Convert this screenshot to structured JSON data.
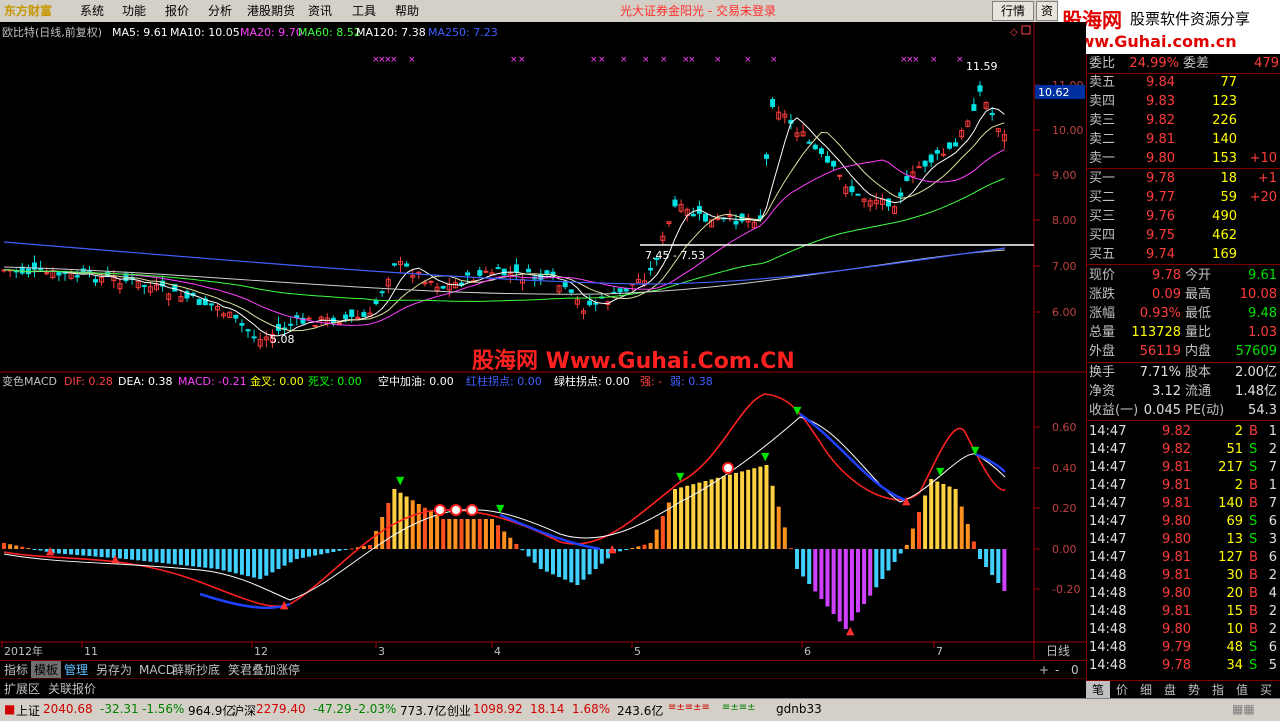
{
  "menubar": {
    "logo": "东方财富",
    "items": [
      "系统",
      "功能",
      "报价",
      "分析",
      "港股期货",
      "资讯",
      "工具",
      "帮助"
    ],
    "broker_text": "光大证券金阳光 - 交易未登录",
    "quote_button": "行情",
    "info_button": "资"
  },
  "banner": {
    "title": "股海网",
    "subtitle": "股票软件资源分享",
    "url": "Www.Guhai.com.cn"
  },
  "main_chart": {
    "title": "欧比特(日线,前复权)",
    "ma": [
      {
        "label": "MA5: 9.61",
        "color": "#ffffff"
      },
      {
        "label": "MA10: 10.05",
        "color": "#ffffff"
      },
      {
        "label": "MA20: 9.70",
        "color": "#ff40ff"
      },
      {
        "label": "MA60: 8.52",
        "color": "#40ff40"
      },
      {
        "label": "MA120: 7.38",
        "color": "#ffffff"
      },
      {
        "label": "MA250: 7.23",
        "color": "#4060ff"
      }
    ],
    "y_ticks": [
      "11.00",
      "10.00",
      "9.00",
      "8.00",
      "7.00",
      "6.00"
    ],
    "current_price_tag": "10.62",
    "annotation_high": "11.59",
    "annotation_low": "5.08",
    "annotation_range": "7.45 - 7.53",
    "watermark": "股海网 Www.Guhai.Com.CN"
  },
  "indicator": {
    "name": "变色MACD",
    "items": [
      {
        "label": "DIF: 0.28",
        "color": "#ff4040"
      },
      {
        "label": "DEA: 0.38",
        "color": "#ffffff"
      },
      {
        "label": "MACD: -0.21",
        "color": "#ff40ff"
      },
      {
        "label": "金叉: 0.00",
        "color": "#ffff00"
      },
      {
        "label": "死叉: 0.00",
        "color": "#00ff00"
      },
      {
        "label": "空中加油: 0.00",
        "color": "#ffffff"
      },
      {
        "label": "红柱拐点: 0.00",
        "color": "#4060ff"
      },
      {
        "label": "绿柱拐点: 0.00",
        "color": "#ffffff"
      },
      {
        "label": "强: -",
        "color": "#ff4040"
      },
      {
        "label": "弱: 0.38",
        "color": "#4060ff"
      }
    ],
    "y_ticks": [
      "0.60",
      "0.40",
      "0.20",
      "0.00",
      "-0.20"
    ]
  },
  "x_axis": {
    "labels": [
      "2012年",
      "11",
      "12",
      "3",
      "4",
      "5",
      "6",
      "7"
    ],
    "period": "日线"
  },
  "tabs": {
    "items": [
      "指标",
      "模板",
      "管理",
      "另存为",
      "MACD",
      "薛斯抄底",
      "笑君叠加涨停"
    ],
    "ext": [
      "扩展区",
      "关联报价"
    ],
    "controls": [
      "+",
      "-",
      "0"
    ]
  },
  "quote_panel": {
    "weibi": {
      "label": "委比",
      "value": "24.99%",
      "label2": "委差",
      "value2": "479"
    },
    "asks": [
      {
        "label": "卖五",
        "price": "9.84",
        "vol": "77",
        "chg": ""
      },
      {
        "label": "卖四",
        "price": "9.83",
        "vol": "123",
        "chg": ""
      },
      {
        "label": "卖三",
        "price": "9.82",
        "vol": "226",
        "chg": ""
      },
      {
        "label": "卖二",
        "price": "9.81",
        "vol": "140",
        "chg": ""
      },
      {
        "label": "卖一",
        "price": "9.80",
        "vol": "153",
        "chg": "+10"
      }
    ],
    "bids": [
      {
        "label": "买一",
        "price": "9.78",
        "vol": "18",
        "chg": "+1"
      },
      {
        "label": "买二",
        "price": "9.77",
        "vol": "59",
        "chg": "+20"
      },
      {
        "label": "买三",
        "price": "9.76",
        "vol": "490",
        "chg": ""
      },
      {
        "label": "买四",
        "price": "9.75",
        "vol": "462",
        "chg": ""
      },
      {
        "label": "买五",
        "price": "9.74",
        "vol": "169",
        "chg": ""
      }
    ],
    "stats": [
      {
        "l1": "现价",
        "v1": "9.78",
        "c1": "red",
        "l2": "今开",
        "v2": "9.61",
        "c2": "green"
      },
      {
        "l1": "涨跌",
        "v1": "0.09",
        "c1": "red",
        "l2": "最高",
        "v2": "10.08",
        "c2": "red"
      },
      {
        "l1": "涨幅",
        "v1": "0.93%",
        "c1": "red",
        "l2": "最低",
        "v2": "9.48",
        "c2": "green"
      },
      {
        "l1": "总量",
        "v1": "113728",
        "c1": "yellow",
        "l2": "量比",
        "v2": "1.03",
        "c2": "red"
      },
      {
        "l1": "外盘",
        "v1": "56119",
        "c1": "red",
        "l2": "内盘",
        "v2": "57609",
        "c2": "green"
      }
    ],
    "fund": [
      {
        "l1": "换手",
        "v1": "7.71%",
        "l2": "股本",
        "v2": "2.00亿"
      },
      {
        "l1": "净资",
        "v1": "3.12",
        "l2": "流通",
        "v2": "1.48亿"
      },
      {
        "l1": "收益(一)",
        "v1": "0.045",
        "l2": "PE(动)",
        "v2": "54.3"
      }
    ],
    "ticks": [
      {
        "time": "14:47",
        "price": "9.82",
        "vol": "2",
        "bs": "B",
        "n": "1"
      },
      {
        "time": "14:47",
        "price": "9.82",
        "vol": "51",
        "bs": "S",
        "n": "2"
      },
      {
        "time": "14:47",
        "price": "9.81",
        "vol": "217",
        "bs": "S",
        "n": "7"
      },
      {
        "time": "14:47",
        "price": "9.81",
        "vol": "2",
        "bs": "B",
        "n": "1"
      },
      {
        "time": "14:47",
        "price": "9.81",
        "vol": "140",
        "bs": "B",
        "n": "7"
      },
      {
        "time": "14:47",
        "price": "9.80",
        "vol": "69",
        "bs": "S",
        "n": "6"
      },
      {
        "time": "14:47",
        "price": "9.80",
        "vol": "13",
        "bs": "S",
        "n": "3"
      },
      {
        "time": "14:47",
        "price": "9.81",
        "vol": "127",
        "bs": "B",
        "n": "6"
      },
      {
        "time": "14:48",
        "price": "9.81",
        "vol": "30",
        "bs": "B",
        "n": "2"
      },
      {
        "time": "14:48",
        "price": "9.80",
        "vol": "20",
        "bs": "B",
        "n": "4"
      },
      {
        "time": "14:48",
        "price": "9.81",
        "vol": "15",
        "bs": "B",
        "n": "2"
      },
      {
        "time": "14:48",
        "price": "9.80",
        "vol": "10",
        "bs": "B",
        "n": "2"
      },
      {
        "time": "14:48",
        "price": "9.79",
        "vol": "48",
        "bs": "S",
        "n": "6"
      },
      {
        "time": "14:48",
        "price": "9.78",
        "vol": "34",
        "bs": "S",
        "n": "5"
      }
    ],
    "tabs": [
      "笔",
      "价",
      "细",
      "盘",
      "势",
      "指",
      "值",
      "买"
    ]
  },
  "statusbar": {
    "sh_label": "上证",
    "sh_val": "2040.68",
    "sh_chg": "-32.31",
    "sh_pct": "-1.56%",
    "sh_amt": "964.9亿",
    "sz_label": "沪深",
    "sz_val": "2279.40",
    "sz_chg": "-47.29",
    "sz_pct": "-2.03%",
    "sz_amt": "773.7亿",
    "cy_label": "创业",
    "cy_val": "1098.92",
    "cy_chg": "18.14",
    "cy_pct": "1.68%",
    "cy_amt": "243.6亿",
    "user": "gdnb33"
  },
  "colors": {
    "up": "#ff3c3c",
    "down": "#00e0e0",
    "ma60": "#40ff40",
    "ma250": "#4060ff",
    "ma20": "#ff40ff",
    "macd_pos": "#ffb000",
    "macd_neg": "#40d0ff"
  }
}
